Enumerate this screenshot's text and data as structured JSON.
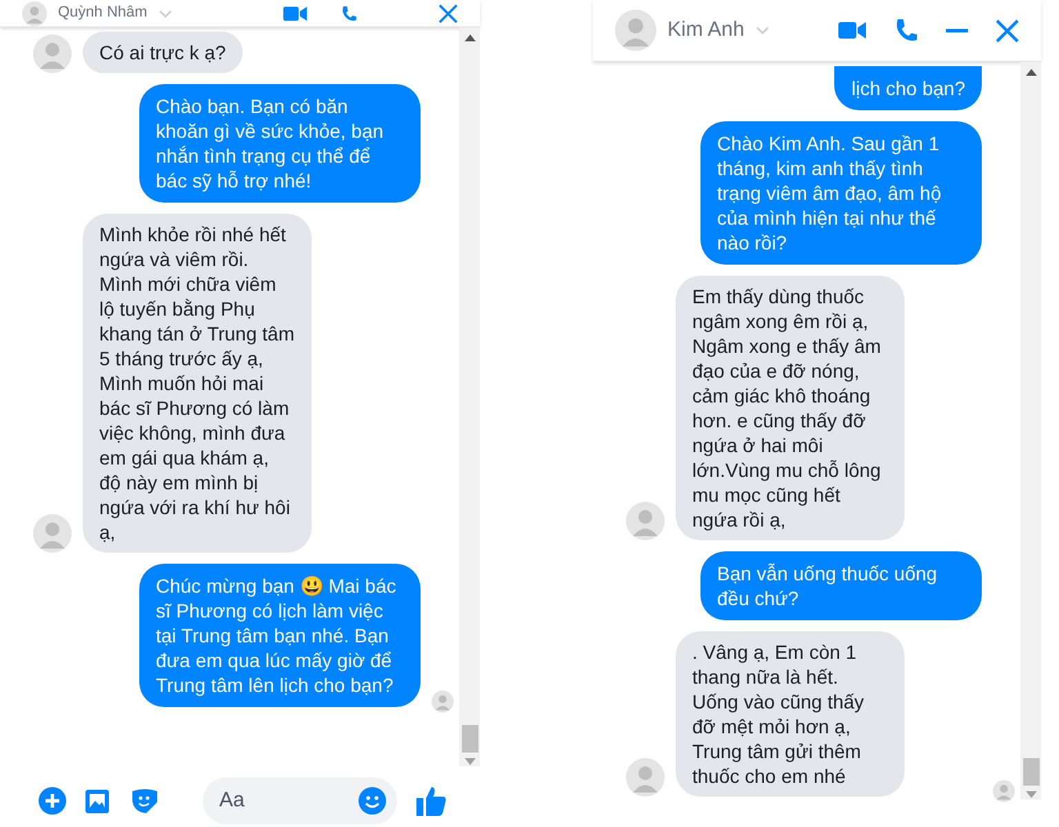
{
  "windows": [
    {
      "contact_name": "Quỳnh Nhâm",
      "composer": {
        "placeholder": "Aa"
      },
      "messages": [
        {
          "kind": "received",
          "text": "Có ai trực k ạ?"
        },
        {
          "kind": "sent",
          "text": "Chào bạn. Bạn có băn khoăn gì về sức khỏe, bạn nhắn tình trạng cụ thể để bác sỹ hỗ trợ nhé!"
        },
        {
          "kind": "received",
          "text": "Mình khỏe rồi nhé hết ngứa và viêm rồi. Mình mới chữa viêm lộ tuyến bằng Phụ khang tán ở Trung tâm 5 tháng trước ấy ạ, Mình muốn hỏi mai bác sĩ Phương có làm việc không, mình đưa em gái qua khám ạ, độ này em mình bị ngứa với ra khí hư hôi ạ,"
        },
        {
          "kind": "sent",
          "text": "Chúc mừng bạn 😃 Mai bác sĩ Phương có lịch làm việc tại Trung tâm bạn nhé. Bạn đưa em qua lúc mấy giờ để Trung tâm lên lịch cho bạn?"
        }
      ]
    },
    {
      "contact_name": "Kim Anh",
      "messages": [
        {
          "kind": "sent",
          "text": "lịch cho bạn?",
          "cut_off": true
        },
        {
          "kind": "sent",
          "text": "Chào Kim Anh. Sau gần 1 tháng, kim anh thấy tình trạng viêm âm đạo, âm hộ của mình hiện tại như thế nào rồi?"
        },
        {
          "kind": "received",
          "text": "Em thấy dùng thuốc ngâm xong êm rồi ạ, Ngâm xong e thấy âm đạo của e đỡ nóng, cảm giác khô thoáng hơn. e cũng thấy đỡ ngứa ở hai môi lớn.Vùng mu chỗ lông mu mọc cũng hết ngứa rồi ạ,"
        },
        {
          "kind": "sent",
          "text": "Bạn vẫn uống thuốc uống đều chứ?"
        },
        {
          "kind": "received",
          "text": ". Vâng ạ, Em còn 1 thang nữa là hết. Uống vào cũng thấy đỡ mệt mỏi hơn ạ, Trung tâm gửi thêm thuốc cho em nhé"
        }
      ]
    }
  ]
}
